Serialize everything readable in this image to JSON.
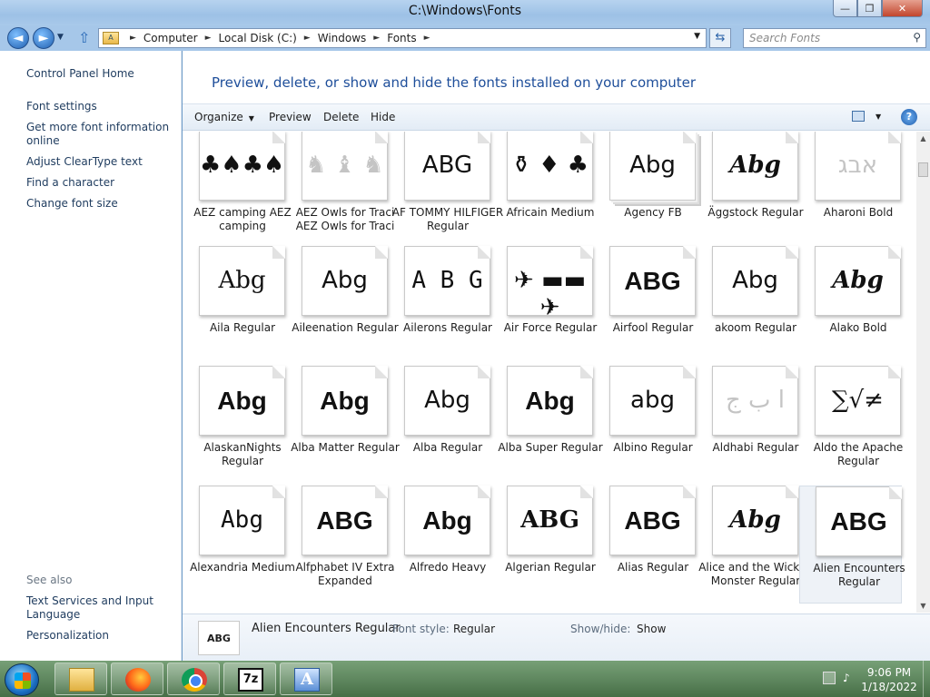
{
  "window": {
    "title": "C:\\Windows\\Fonts",
    "minimize": "—",
    "maximize": "❐",
    "close": "✕"
  },
  "address": {
    "crumbs": [
      "Computer",
      "Local Disk (C:)",
      "Windows",
      "Fonts"
    ],
    "search_placeholder": "Search Fonts"
  },
  "left_pane": {
    "control_panel_home": "Control Panel Home",
    "links": [
      "Font settings",
      "Get more font information online",
      "Adjust ClearType text",
      "Find a character",
      "Change font size"
    ],
    "see_also_title": "See also",
    "see_also": [
      "Text Services and Input Language",
      "Personalization"
    ]
  },
  "main": {
    "heading": "Preview, delete, or show and hide the fonts installed on your computer",
    "toolbar": {
      "organize": "Organize",
      "preview": "Preview",
      "delete": "Delete",
      "hide": "Hide",
      "help": "?"
    }
  },
  "fonts": [
    {
      "name": "AEZ camping AEZ camping",
      "sample": "♣♠♣♠",
      "style": "plain"
    },
    {
      "name": "AEZ Owls for Traci AEZ Owls for Traci",
      "sample": "♞ ♝ ♞",
      "style": "faint"
    },
    {
      "name": "AF TOMMY HILFIGER Regular",
      "sample": "ABG",
      "style": "plain"
    },
    {
      "name": "Africain Medium",
      "sample": "⚱ ♦ ♣",
      "style": "plain"
    },
    {
      "name": "Agency FB",
      "sample": "Abg",
      "style": "stack"
    },
    {
      "name": "Äggstock Regular",
      "sample": "Abg",
      "style": "italic"
    },
    {
      "name": "Aharoni Bold",
      "sample": "אבג",
      "style": "faint"
    },
    {
      "name": "Aila Regular",
      "sample": "Abg",
      "style": "serif"
    },
    {
      "name": "Aileenation Regular",
      "sample": "Abg",
      "style": "plain"
    },
    {
      "name": "Ailerons Regular",
      "sample": "A B G",
      "style": "mono"
    },
    {
      "name": "Air Force Regular",
      "sample": "✈ ▬▬ ✈",
      "style": "plain"
    },
    {
      "name": "Airfool Regular",
      "sample": "ABG",
      "style": "heavy"
    },
    {
      "name": "akoom Regular",
      "sample": "Abg",
      "style": "plain"
    },
    {
      "name": "Alako Bold",
      "sample": "Abg",
      "style": "italic"
    },
    {
      "name": "AlaskanNights Regular",
      "sample": "Abg",
      "style": "heavy"
    },
    {
      "name": "Alba Matter Regular",
      "sample": "Abg",
      "style": "heavy"
    },
    {
      "name": "Alba Regular",
      "sample": "Abg",
      "style": "plain"
    },
    {
      "name": "Alba Super Regular",
      "sample": "Abg",
      "style": "heavy"
    },
    {
      "name": "Albino Regular",
      "sample": "abg",
      "style": "plain"
    },
    {
      "name": "Aldhabi Regular",
      "sample": "ا ب ج",
      "style": "faint"
    },
    {
      "name": "Aldo the Apache Regular",
      "sample": "∑√≠",
      "style": "serif"
    },
    {
      "name": "Alexandria Medium",
      "sample": "Abg",
      "style": "mono"
    },
    {
      "name": "Alfphabet IV Extra Expanded",
      "sample": "ABG",
      "style": "heavy"
    },
    {
      "name": "Alfredo Heavy",
      "sample": "Abg",
      "style": "heavy"
    },
    {
      "name": "Algerian Regular",
      "sample": "ABG",
      "style": "serifbold"
    },
    {
      "name": "Alias Regular",
      "sample": "ABG",
      "style": "heavy"
    },
    {
      "name": "Alice and the Wicked Monster Regular",
      "sample": "Abg",
      "style": "italic"
    },
    {
      "name": "Alien Encounters Regular",
      "sample": "ABG",
      "style": "heavy",
      "selected": true
    }
  ],
  "details": {
    "sample": "ABG",
    "name": "Alien Encounters Regular",
    "font_style_label": "Font style:",
    "font_style_value": "Regular",
    "showhide_label": "Show/hide:",
    "showhide_value": "Show"
  },
  "taskbar": {
    "apps": [
      "Windows Explorer",
      "Firefox",
      "Chrome",
      "7-Zip",
      "Font Viewer"
    ],
    "sevenzip_label": "7z",
    "fontview_label": "A",
    "time": "9:06 PM",
    "date": "1/18/2022"
  }
}
